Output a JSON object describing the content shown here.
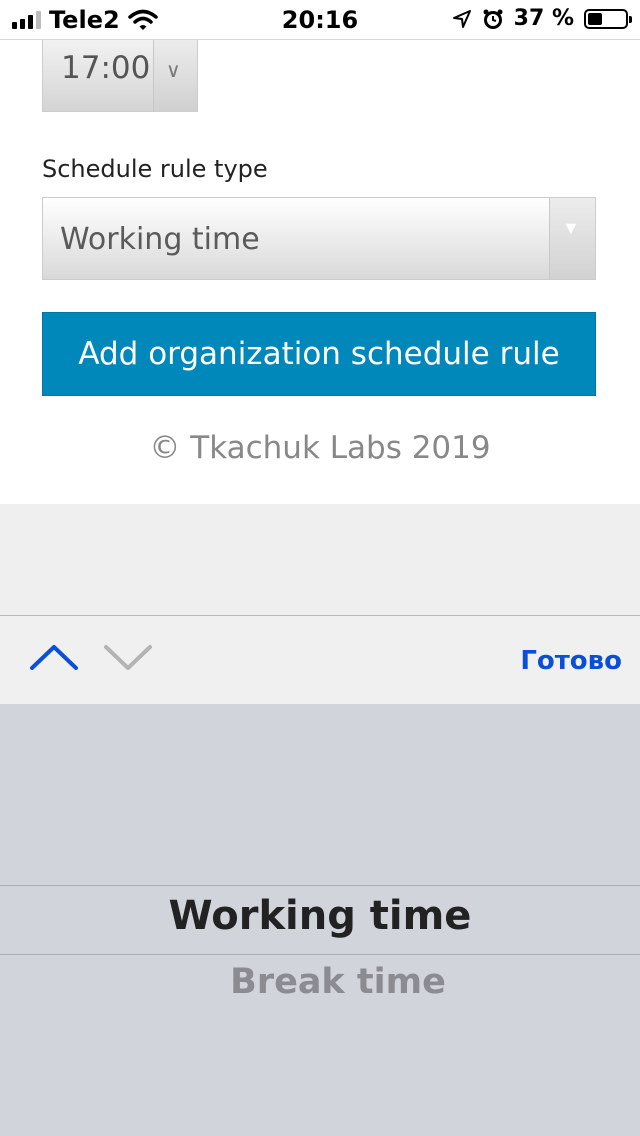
{
  "status_bar": {
    "carrier": "Tele2",
    "time": "20:16",
    "battery_percent": "37 %",
    "icons": [
      "signal-icon",
      "wifi-icon",
      "location-icon",
      "alarm-icon",
      "battery-icon"
    ]
  },
  "form": {
    "time_value": "17:00",
    "rule_type_label": "Schedule rule type",
    "rule_type_value": "Working time",
    "submit_label": "Add organization schedule rule",
    "footer": "© Tkachuk Labs 2019"
  },
  "keyboard_toolbar": {
    "done_label": "Готово",
    "done_color": "#0b4fd6"
  },
  "picker": {
    "options": [
      "Working time",
      "Break time"
    ],
    "selected": "Working time"
  },
  "colors": {
    "button_bg": "#0088bb",
    "picker_bg": "#d1d4db"
  }
}
